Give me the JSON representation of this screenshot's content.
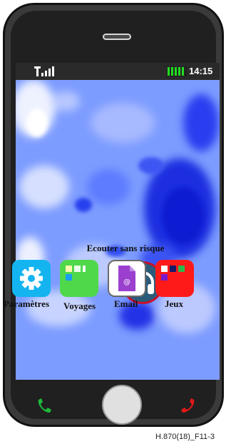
{
  "status_bar": {
    "time": "14:15"
  },
  "featured_app": {
    "label": "Ecouter sans risque",
    "icon": "headphones-icon"
  },
  "dock": [
    {
      "label": "Paramètres",
      "icon": "gear-icon",
      "color": "#13b4f0"
    },
    {
      "label": "Voyages",
      "icon": "tiles-icon",
      "color": "#4fd84a"
    },
    {
      "label": "Email",
      "icon": "email-document-icon",
      "color": "#ffffff"
    },
    {
      "label": "Jeux",
      "icon": "tiles-icon",
      "color": "#ff1a1a"
    }
  ],
  "controls": {
    "call": "call-icon",
    "home": "home-button",
    "hangup": "hangup-icon"
  },
  "caption": "H.870(18)_F11-3"
}
